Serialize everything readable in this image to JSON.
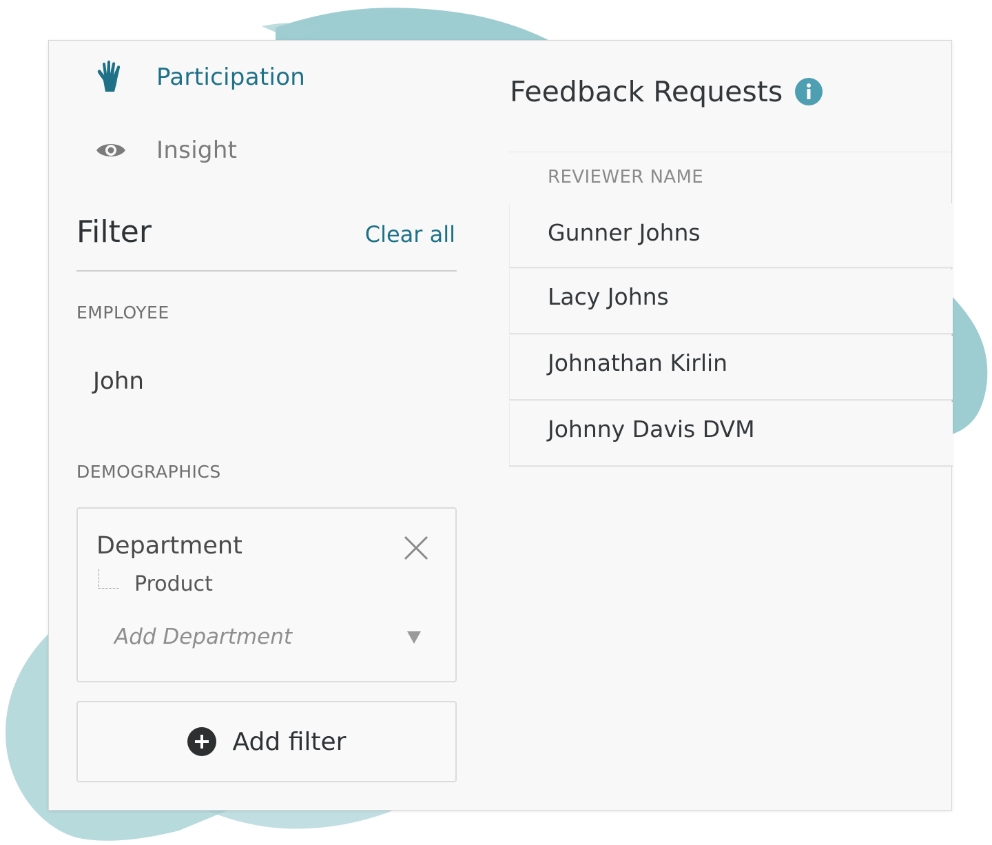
{
  "nav": {
    "items": [
      {
        "label": "Participation",
        "icon": "hand-icon",
        "active": true
      },
      {
        "label": "Insight",
        "icon": "eye-icon",
        "active": false
      }
    ]
  },
  "filter": {
    "title": "Filter",
    "clear_label": "Clear all",
    "employee_label": "EMPLOYEE",
    "employee_value": "John",
    "demographics_label": "DEMOGRAPHICS",
    "department": {
      "title": "Department",
      "selected": "Product",
      "add_placeholder": "Add Department"
    },
    "add_filter_label": "Add filter"
  },
  "feedback": {
    "title": "Feedback Requests",
    "column_header": "REVIEWER NAME",
    "rows": [
      {
        "name": "Gunner Johns"
      },
      {
        "name": "Lacy Johns"
      },
      {
        "name": "Johnathan Kirlin"
      },
      {
        "name": "Johnny Davis DVM"
      }
    ]
  },
  "colors": {
    "accent": "#1e7187",
    "info": "#4e9fb1",
    "splash": "#8cc3c9"
  }
}
